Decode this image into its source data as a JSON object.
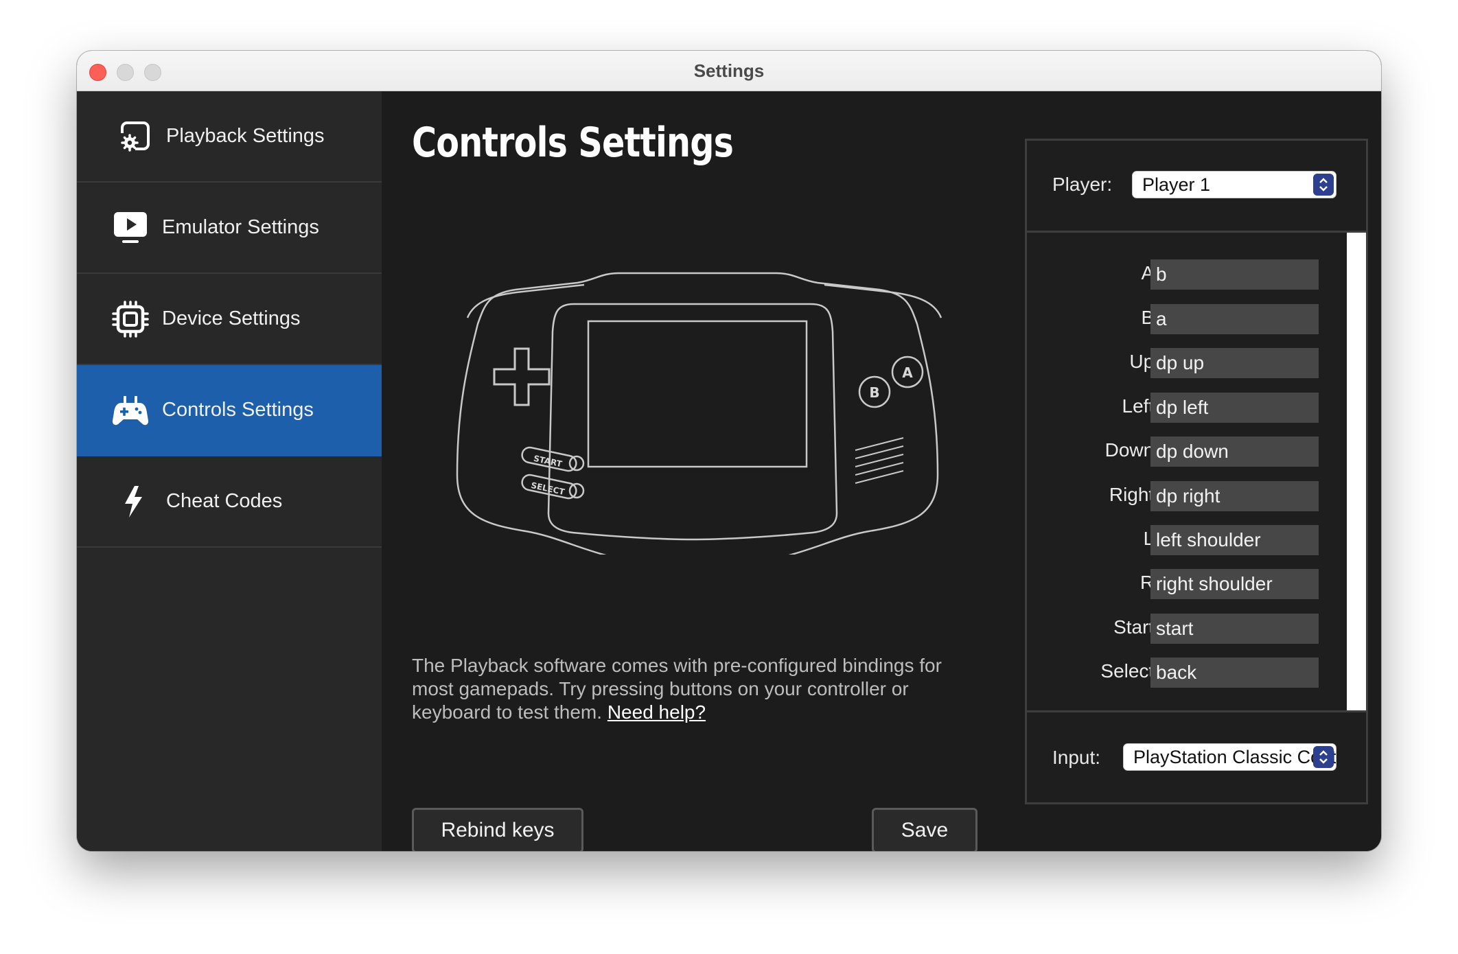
{
  "window": {
    "title": "Settings"
  },
  "sidebar": {
    "items": [
      {
        "label": "Playback Settings",
        "icon": "gear-screen-icon",
        "active": false
      },
      {
        "label": "Emulator Settings",
        "icon": "play-screen-icon",
        "active": false
      },
      {
        "label": "Device Settings",
        "icon": "chip-icon",
        "active": false
      },
      {
        "label": "Controls Settings",
        "icon": "gamepad-icon",
        "active": true
      },
      {
        "label": "Cheat Codes",
        "icon": "lightning-icon",
        "active": false
      }
    ]
  },
  "main": {
    "title": "Controls Settings",
    "device_labels": {
      "start": "START",
      "select": "SELECT",
      "a": "A",
      "b": "B"
    },
    "description": "The Playback software comes with pre-configured bindings for most gamepads. Try pressing buttons on your controller or keyboard to test them.",
    "help_link": "Need help?",
    "rebind_button": "Rebind keys",
    "save_button": "Save"
  },
  "panel": {
    "player_label": "Player:",
    "player_value": "Player 1",
    "input_label": "Input:",
    "input_value": "PlayStation Classic Controller",
    "bindings": [
      {
        "label": "A:",
        "value": "b"
      },
      {
        "label": "B:",
        "value": "a"
      },
      {
        "label": "Up:",
        "value": "dp up"
      },
      {
        "label": "Left:",
        "value": "dp left"
      },
      {
        "label": "Down:",
        "value": "dp down"
      },
      {
        "label": "Right:",
        "value": "dp right"
      },
      {
        "label": "L:",
        "value": "left shoulder"
      },
      {
        "label": "R:",
        "value": "right shoulder"
      },
      {
        "label": "Start:",
        "value": "start"
      },
      {
        "label": "Select:",
        "value": "back"
      }
    ]
  },
  "colors": {
    "accent": "#1d5faa",
    "sidebar_bg": "#282828",
    "main_bg": "#1c1c1c",
    "field_bg": "#474747",
    "close": "#fe5f57"
  }
}
